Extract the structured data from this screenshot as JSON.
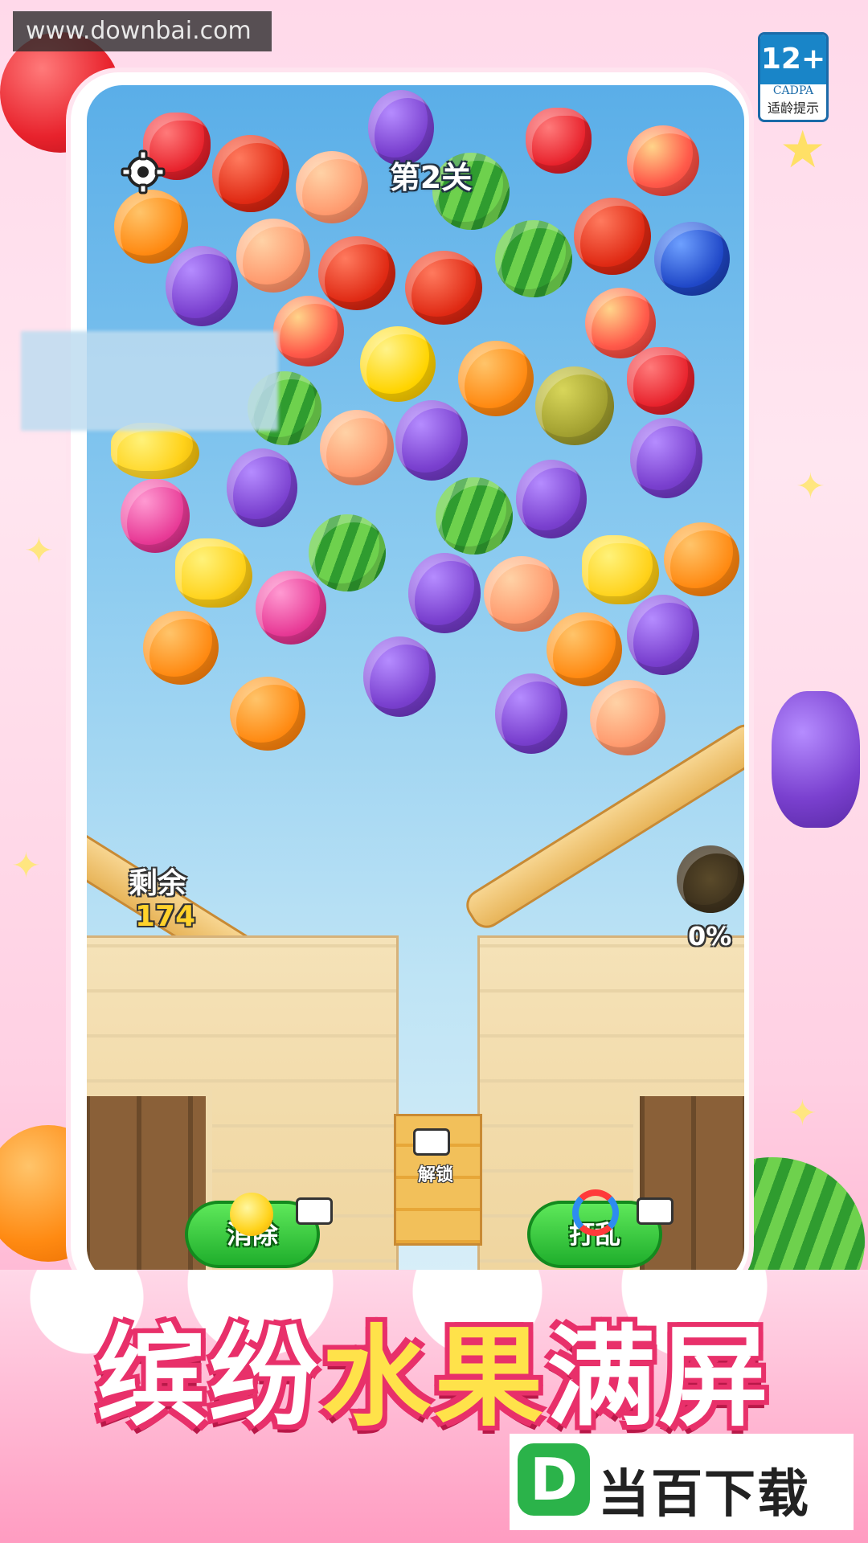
{
  "watermark": {
    "text": "www.downbai.com"
  },
  "age_rating": {
    "rating": "12+",
    "org": "CADPA",
    "caption": "适龄提示"
  },
  "game": {
    "level_label": "第2关",
    "remaining_label": "剩余",
    "remaining_value": "174",
    "progress_percent": "0%",
    "unlock_label": "解锁",
    "buttons": {
      "eliminate": "消除",
      "shuffle": "打乱"
    }
  },
  "icons": {
    "settings": "gear-icon",
    "video_ad": "video-camera-icon",
    "hint": "lightbulb-icon",
    "shuffle": "shuffle-arrows-icon"
  },
  "headline": {
    "part1": "缤纷",
    "part2": "水果",
    "part3": "满屏"
  },
  "brand": {
    "logo_letter": "D",
    "name": "当百下载"
  },
  "colors": {
    "button_green": "#1fae2c",
    "headline_pink": "#e8306a",
    "headline_yellow": "#ffe24a",
    "sky_blue": "#5aaee8"
  }
}
